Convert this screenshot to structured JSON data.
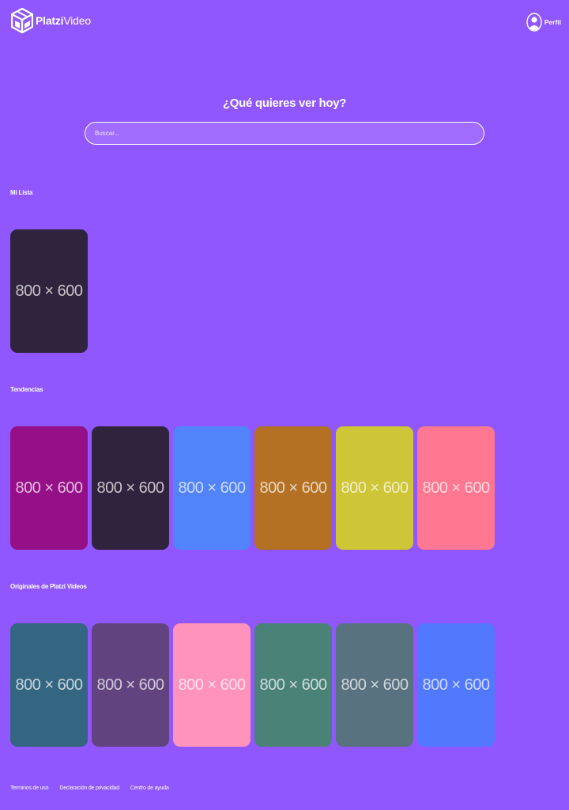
{
  "header": {
    "logo_bold_part": "Platzi",
    "logo_light_part": "Video",
    "logo_icon": "cube-video-icon",
    "profile_label": "Perfil",
    "profile_icon": "user-avatar-icon"
  },
  "hero": {
    "title": "¿Qué quieres ver hoy?",
    "search_placeholder": "Buscar..."
  },
  "sections": [
    {
      "title": "Mi Lista",
      "items": [
        {
          "label": "800 × 600",
          "color": "#30233d"
        }
      ]
    },
    {
      "title": "Tendencias",
      "items": [
        {
          "label": "800 × 600",
          "color": "#950f87"
        },
        {
          "label": "800 × 600",
          "color": "#30233d"
        },
        {
          "label": "800 × 600",
          "color": "#5183fb"
        },
        {
          "label": "800 × 600",
          "color": "#b47023"
        },
        {
          "label": "800 × 600",
          "color": "#cec537"
        },
        {
          "label": "800 × 600",
          "color": "#ff7790"
        }
      ]
    },
    {
      "title": "Originales de Platzi Videos",
      "items": [
        {
          "label": "800 × 600",
          "color": "#346581"
        },
        {
          "label": "800 × 600",
          "color": "#61437f"
        },
        {
          "label": "800 × 600",
          "color": "#ff93bb"
        },
        {
          "label": "800 × 600",
          "color": "#4b8277"
        },
        {
          "label": "800 × 600",
          "color": "#58727f"
        },
        {
          "label": "800 × 600",
          "color": "#5279fd"
        }
      ]
    }
  ],
  "footer": {
    "links": [
      "Terminos de uso",
      "Declaración de privacidad",
      "Centro de ayuda"
    ]
  },
  "colors": {
    "background": "#8f57fd",
    "search_fill": "#a06bff",
    "text": "#ffffff"
  }
}
